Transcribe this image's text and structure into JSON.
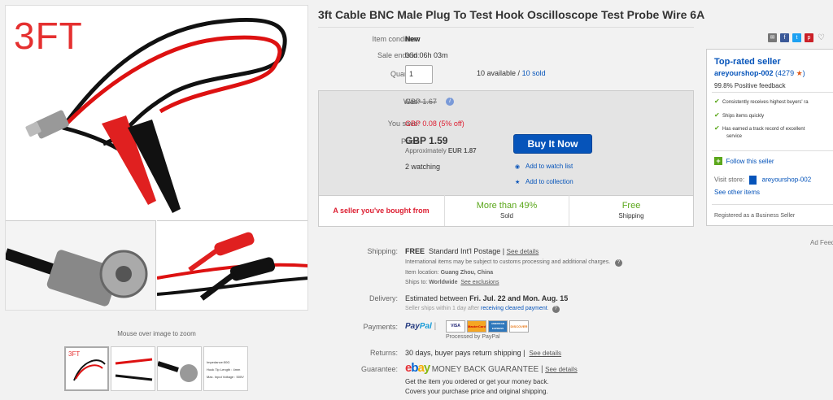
{
  "gallery": {
    "badge": "3FT",
    "zoom_hint": "Mouse over image to zoom",
    "thumb_badge": "3FT",
    "thumb_specs": [
      "Impedance:50Ω",
      "Hook Tip Length : 4mm",
      "Max. Input Voltage : 500V"
    ]
  },
  "item": {
    "title": "3ft Cable BNC Male Plug To Test Hook Oscilloscope Test Probe Wire 6A",
    "condition_label": "Item condition:",
    "condition": "New",
    "ends_label": "Sale ends in:",
    "ends": "06d 06h 03m",
    "quantity_label": "Quantity:",
    "quantity_value": "1",
    "available": "10 available /",
    "sold": "10 sold"
  },
  "price": {
    "was_label": "Was:",
    "was": "GBP 1.67",
    "save_label": "You save:",
    "save": "GBP 0.08 (5% off)",
    "price_label": "Price:",
    "price": "GBP 1.59",
    "approx_label": "Approximately",
    "approx_value": "EUR 1.87",
    "watching": "2 watching",
    "buy_label": "Buy It Now",
    "watch_label": "Add to watch list",
    "collection_label": "Add to collection",
    "seller_bought": "A seller you've bought from",
    "stat1_big": "More than 49%",
    "stat1_small": "Sold",
    "stat2_big": "Free",
    "stat2_small": "Shipping"
  },
  "shipping": {
    "label": "Shipping:",
    "free": "FREE",
    "method": "Standard Int'l Postage |",
    "see_details": "See details",
    "line1": "International items may be subject to customs processing and additional charges.",
    "location_label": "Item location:",
    "location": "Guang Zhou, China",
    "ships_label": "Ships to:",
    "ships_to": "Worldwide",
    "see_exclusions": "See exclusions"
  },
  "delivery": {
    "label": "Delivery:",
    "text": "Estimated between",
    "dates": "Fri. Jul. 22 and Mon. Aug. 15",
    "sub1": "Seller ships within 1 day after",
    "sub_link": "receiving cleared payment",
    "sub2": "."
  },
  "payments": {
    "label": "Payments:",
    "paypal1": "Pay",
    "paypal2": "Pal",
    "cards": [
      "VISA",
      "MasterCard",
      "AMERICAN EXPRESS",
      "DISCOVER"
    ],
    "processed": "Processed by PayPal"
  },
  "returns": {
    "label": "Returns:",
    "text": "30 days, buyer pays return shipping |",
    "see_details": "See details"
  },
  "guarantee": {
    "label": "Guarantee:",
    "logo_e": "e",
    "logo_b": "b",
    "logo_a": "a",
    "logo_y": "y",
    "title": "MONEY BACK GUARANTEE |",
    "see_details": "See details",
    "line1": "Get the item you ordered or get your money back.",
    "line2": "Covers your purchase price and original shipping."
  },
  "seller": {
    "heading": "Top-rated seller",
    "name": "areyourshop-002",
    "feedback_open": "(",
    "feedback_score": "4279",
    "feedback_close": ")",
    "positive": "99.8% Positive feedback",
    "bullets": [
      "Consistently receives highest buyers' ra",
      "Ships items quickly",
      "Has earned a track record of excellent",
      "service"
    ],
    "follow": "Follow this seller",
    "visit_label": "Visit store:",
    "store": "areyourshop-002",
    "other_items": "See other items",
    "registered": "Registered as a Business Seller"
  },
  "ad_feedback": "Ad Feed",
  "colors": {
    "link": "#0654ba",
    "buy": "#0654ba",
    "sale": "#dd1e31",
    "green": "#5ba71b"
  },
  "icons": [
    "email-icon",
    "facebook-icon",
    "twitter-icon",
    "pinterest-icon",
    "heart-icon",
    "info-icon",
    "eye-icon",
    "star-icon",
    "check-icon",
    "plus-icon",
    "store-icon",
    "question-icon"
  ]
}
